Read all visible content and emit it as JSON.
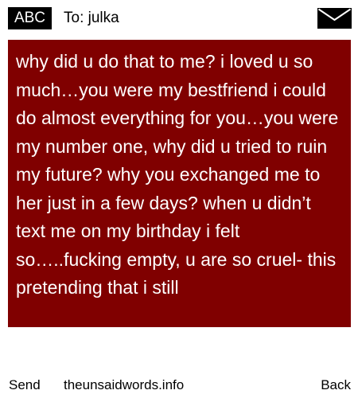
{
  "header": {
    "badge": "ABC",
    "recipient": "To: julka",
    "icon": "envelope-icon"
  },
  "message": {
    "text": "why did u do that to me? i loved u so much…you were my bestfriend i could do almost everything for you…you were my number one, why did u tried to ruin my future? why you exchanged me to her just in a few days? when u didn’t text me on my birthday i felt so…..fucking empty, u are so cruel- this pretending that i still"
  },
  "footer": {
    "send_label": "Send",
    "site": "theunsaidwords.info",
    "back_label": "Back"
  },
  "colors": {
    "message_background": "#800000",
    "message_text": "#ffffff",
    "badge_background": "#000000"
  }
}
